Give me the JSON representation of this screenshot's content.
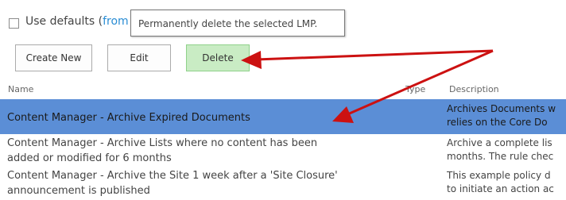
{
  "defaults": {
    "label": "Use defaults (",
    "link_text": "from"
  },
  "tooltip": {
    "text": "Permanently delete the selected LMP."
  },
  "toolbar": {
    "create_label": "Create New",
    "edit_label": "Edit",
    "delete_label": "Delete"
  },
  "columns": {
    "name": "Name",
    "type": "Type",
    "description": "Description"
  },
  "rows": [
    {
      "name_lines": [
        "Content Manager - Archive Expired Documents"
      ],
      "description_lines": [
        "Archives Documents w",
        "relies on the Core Do"
      ],
      "selected": true
    },
    {
      "name_lines": [
        "Content Manager - Archive Lists where no content has been",
        "added or modified for 6 months"
      ],
      "description_lines": [
        "Archive a complete lis",
        "months. The rule chec"
      ],
      "selected": false
    },
    {
      "name_lines": [
        "Content Manager - Archive the Site 1 week after a 'Site Closure'",
        "announcement is published"
      ],
      "description_lines": [
        "This example policy d",
        "to initiate an action ac"
      ],
      "selected": false
    }
  ],
  "colors": {
    "selected_row": "#5b8ed6",
    "delete_button": "#c9ecc4",
    "link": "#2a8dd4",
    "annotation_arrow": "#cc1111"
  }
}
